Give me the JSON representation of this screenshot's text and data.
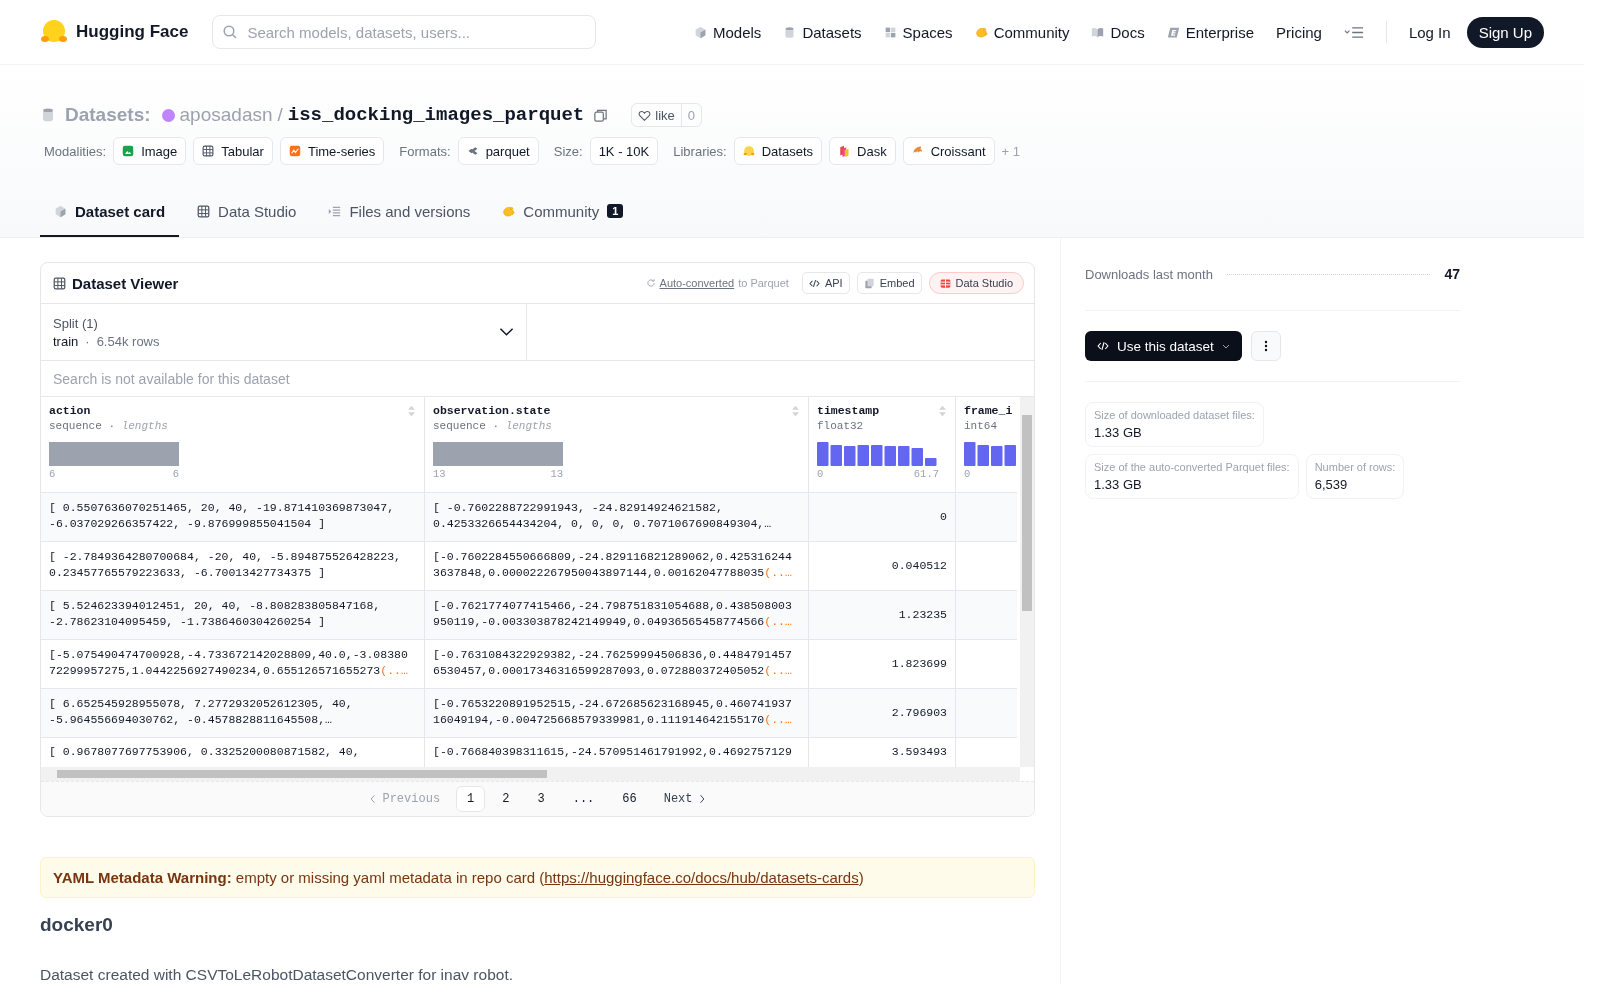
{
  "header": {
    "logo": "Hugging Face",
    "search_placeholder": "Search models, datasets, users...",
    "nav": [
      {
        "label": "Models"
      },
      {
        "label": "Datasets"
      },
      {
        "label": "Spaces"
      },
      {
        "label": "Community"
      },
      {
        "label": "Docs"
      },
      {
        "label": "Enterprise"
      },
      {
        "label": "Pricing"
      }
    ],
    "login": "Log In",
    "signup": "Sign Up"
  },
  "repo": {
    "section": "Datasets:",
    "owner": "aposadasn",
    "separator": "/",
    "name": "iss_docking_images_parquet",
    "like_label": "like",
    "like_count": "0"
  },
  "tag_groups": [
    {
      "label": "Modalities:",
      "tags": [
        {
          "label": "Image"
        },
        {
          "label": "Tabular"
        },
        {
          "label": "Time-series"
        }
      ]
    },
    {
      "label": "Formats:",
      "tags": [
        {
          "label": "parquet"
        }
      ]
    },
    {
      "label": "Size:",
      "tags": [
        {
          "label": "1K - 10K"
        }
      ]
    },
    {
      "label": "Libraries:",
      "tags": [
        {
          "label": "Datasets"
        },
        {
          "label": "Dask"
        },
        {
          "label": "Croissant"
        }
      ]
    }
  ],
  "more_tags": "+ 1",
  "tabs": [
    {
      "label": "Dataset card",
      "selected": true
    },
    {
      "label": "Data Studio",
      "selected": false
    },
    {
      "label": "Files and versions",
      "selected": false
    },
    {
      "label": "Community",
      "selected": false,
      "badge": "1"
    }
  ],
  "viewer": {
    "title": "Dataset Viewer",
    "converted_link": "Auto-converted",
    "converted_text": "to Parquet",
    "buttons": [
      {
        "label": "API",
        "kind": "plain"
      },
      {
        "label": "Embed",
        "kind": "plain"
      },
      {
        "label": "Data Studio",
        "kind": "accent"
      }
    ],
    "split_label": "Split (1)",
    "split_name": "train",
    "split_separator": "·",
    "split_rows": "6.54k rows",
    "search_placeholder": "Search is not available for this dataset",
    "columns": [
      {
        "name": "action",
        "type": "sequence",
        "separator": "·",
        "note": "lengths",
        "kind": "single",
        "min": "6",
        "max": "6"
      },
      {
        "name": "observation.state",
        "type": "sequence",
        "separator": "·",
        "note": "lengths",
        "kind": "single",
        "min": "13",
        "max": "13"
      },
      {
        "name": "timestamp",
        "type": "float32",
        "kind": "histogram",
        "min": "0",
        "max": "61.7"
      },
      {
        "name": "frame_i",
        "type": "int64",
        "kind": "histogram",
        "min": "0"
      }
    ],
    "rows": [
      {
        "cells": [
          {
            "lines": [
              "[ 0.5507636070251465, 20, 40, -19.871410369873047,",
              "-6.037029266357422, -9.876999855041504 ]"
            ]
          },
          {
            "lines": [
              "[ -0.7602288722991943, -24.82914924621582,",
              "0.4253326654434204, 0, 0, 0, 0.7071067690849304,…"
            ]
          },
          {
            "lines": [
              "0"
            ]
          }
        ]
      },
      {
        "cells": [
          {
            "lines": [
              "[ -2.7849364280700684, -20, 40, -5.894875526428223,",
              "0.23457765579223633, -6.70013427734375 ]"
            ]
          },
          {
            "lines": [
              "[-0.7602284550666809,-24.829116821289062,0.425316244",
              "3637848,0.000022267950043897144,0.00162047788035"
            ],
            "tail": "(..…"
          },
          {
            "lines": [
              "0.040512"
            ]
          }
        ]
      },
      {
        "cells": [
          {
            "lines": [
              "[ 5.524623394012451, 20, 40, -8.808283805847168,",
              "-2.78623104095459, -1.7386460304260254 ]"
            ]
          },
          {
            "lines": [
              "[-0.7621774077415466,-24.798751831054688,0.438508003",
              "950119,-0.003303878242149949,0.04936565458774566"
            ],
            "tail": "(..…"
          },
          {
            "lines": [
              "1.23235"
            ]
          }
        ]
      },
      {
        "cells": [
          {
            "lines": [
              "[-5.075490474700928,-4.733672142028809,40.0,-3.08380",
              "72299957275,1.0442256927490234,0.655126571655273"
            ],
            "tail": "(..…"
          },
          {
            "lines": [
              "[-0.7631084322929382,-24.76259994506836,0.4484791457",
              "6530457,0.00017346316599287093,0.072880372405052"
            ],
            "tail": "(..…"
          },
          {
            "lines": [
              "1.823699"
            ]
          }
        ]
      },
      {
        "cells": [
          {
            "lines": [
              "[ 6.652545928955078, 7.2772932052612305, 40,",
              "-5.964556694030762, -0.4578828811645508,…"
            ]
          },
          {
            "lines": [
              "[-0.7653220891952515,-24.672685623168945,0.460741937",
              "16049194,-0.004725668579339981,0.111914642155170"
            ],
            "tail": "(..…"
          },
          {
            "lines": [
              "2.796903"
            ]
          }
        ]
      },
      {
        "cells": [
          {
            "lines": [
              "[ 0.9678077697753906, 0.3325200080871582, 40,"
            ]
          },
          {
            "lines": [
              "[-0.766840398311615,-24.570951461791992,0.4692757129"
            ]
          },
          {
            "lines": [
              "3.593493"
            ]
          }
        ]
      }
    ],
    "prev": {
      "label": "Previous",
      "disabled": true
    },
    "pages": [
      {
        "label": "1",
        "selected": true
      },
      {
        "label": "2",
        "selected": false
      },
      {
        "label": "3",
        "selected": false
      },
      {
        "label": "...",
        "selected": false
      },
      {
        "label": "66",
        "selected": false
      }
    ],
    "next": {
      "label": "Next",
      "disabled": false
    }
  },
  "warning": {
    "text": "**YAML Metadata Warning:** empty or missing yaml metadata in repo card (",
    "link": "https://huggingface.co/docs/hub/datasets-cards",
    "end": ")"
  },
  "card": {
    "heading": "docker0",
    "text": "Dataset created with CSVToLeRobotDatasetConverter for inav robot."
  },
  "sidebar": {
    "downloads_label": "Downloads last month",
    "downloads": "47",
    "use_button": "Use this dataset",
    "stats": [
      {
        "label": "Size of downloaded dataset files:",
        "value": "1.33 GB"
      },
      {
        "label": "Size of the auto-converted Parquet files:",
        "value": "1.33 GB"
      },
      {
        "label": "Number of rows:",
        "value": "6,539"
      }
    ]
  }
}
